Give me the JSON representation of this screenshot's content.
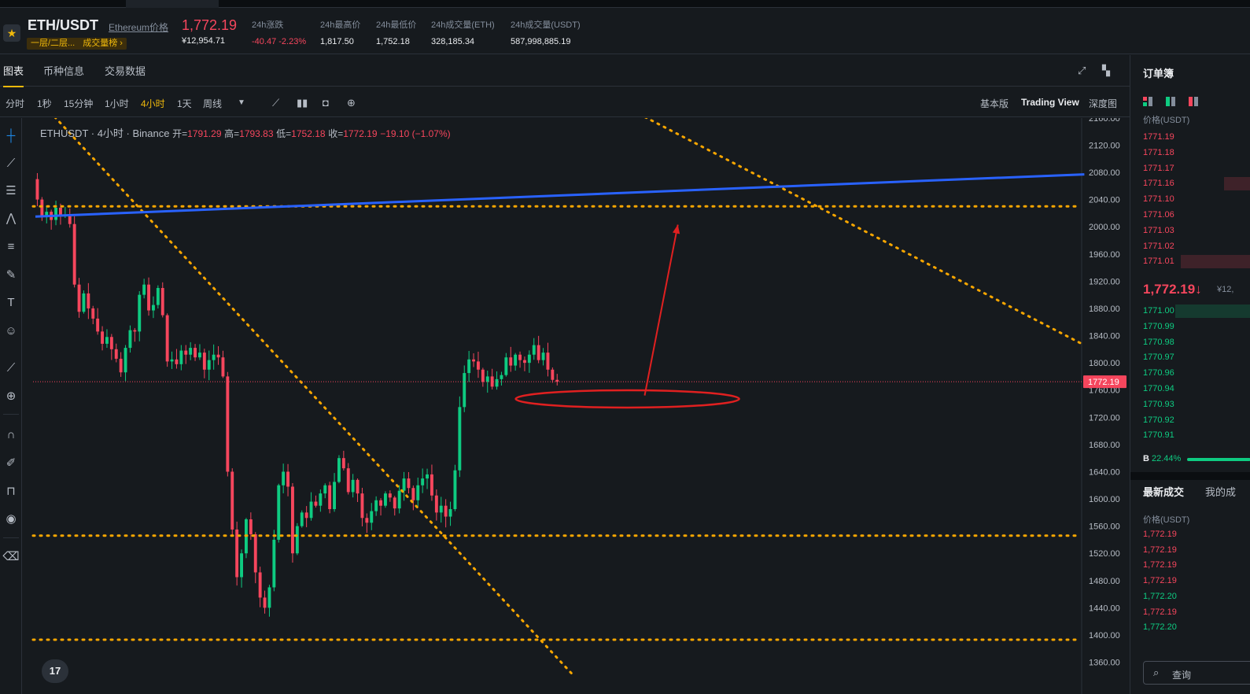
{
  "header": {
    "symbol": "ETH/USDT",
    "symbol_link": "Ethereum价格",
    "tags": [
      "一层/二层...",
      "成交量榜 ›"
    ],
    "last_price": "1,772.19",
    "last_price_fiat": "¥12,954.71",
    "stats": [
      {
        "label": "24h涨跌",
        "value": "-40.47 -2.23%",
        "color": "red"
      },
      {
        "label": "24h最高价",
        "value": "1,817.50"
      },
      {
        "label": "24h最低价",
        "value": "1,752.18"
      },
      {
        "label": "24h成交量(ETH)",
        "value": "328,185.34"
      },
      {
        "label": "24h成交量(USDT)",
        "value": "587,998,885.19"
      }
    ]
  },
  "main_tabs": [
    "图表",
    "币种信息",
    "交易数据"
  ],
  "intervals": [
    "分时",
    "1秒",
    "15分钟",
    "1小时",
    "4小时",
    "1天",
    "周线"
  ],
  "active_interval": "4小时",
  "view_modes": [
    "基本版",
    "Trading View",
    "深度图"
  ],
  "active_view_mode": "Trading View",
  "icons": {
    "star": "star-icon",
    "expand": "expand-icon",
    "layout": "grid-icon",
    "interval_dropdown": "chevron-down-icon",
    "indicators": "indicators-icon",
    "chart_style": "candles-icon",
    "snapshot": "camera-icon",
    "add": "plus-icon",
    "search": "search-icon"
  },
  "left_tools": [
    "crosshair-icon",
    "trendline-icon",
    "horizontal-lines-icon",
    "pattern-icon",
    "fib-icon",
    "brush-icon",
    "text-icon",
    "emoji-icon",
    "ruler-icon",
    "zoom-in-icon",
    "magnet-icon",
    "pencil-lock-icon",
    "lock-icon",
    "eye-icon",
    "trash-icon"
  ],
  "chart_legend": {
    "title": "ETHUSDT · 4小时 · Binance",
    "open_label": "开=",
    "open": "1791.29",
    "high_label": "高=",
    "high": "1793.83",
    "low_label": "低=",
    "low": "1752.18",
    "close_label": "收=",
    "close": "1772.19",
    "change": "−19.10 (−1.07%)"
  },
  "tv_logo": "17",
  "chart_data": {
    "type": "candlestick",
    "title": "ETHUSDT · 4小时 · Binance",
    "ylim": [
      1340,
      2170
    ],
    "y_ticks": [
      2160,
      2120,
      2080,
      2040,
      2000,
      1960,
      1920,
      1880,
      1840,
      1800,
      1760,
      1720,
      1680,
      1640,
      1600,
      1560,
      1520,
      1480,
      1440,
      1400,
      1360
    ],
    "y_tick_labels": [
      "2160.00",
      "2120.00",
      "2080.00",
      "2040.00",
      "2000.00",
      "1960.00",
      "1920.00",
      "1880.00",
      "1840.00",
      "1800.00",
      "1760.00",
      "1720.00",
      "1680.00",
      "1640.00",
      "1600.00",
      "1560.00",
      "1520.00",
      "1480.00",
      "1440.00",
      "1400.00",
      "1360.00"
    ],
    "current_price": 1772.19,
    "current_price_label": "1772.19",
    "closes": [
      2040,
      2014,
      2022,
      2010,
      2028,
      2016,
      2018,
      2004,
      1915,
      1875,
      1902,
      1880,
      1865,
      1846,
      1828,
      1838,
      1820,
      1806,
      1786,
      1822,
      1848,
      1846,
      1900,
      1915,
      1877,
      1885,
      1910,
      1870,
      1802,
      1805,
      1798,
      1818,
      1812,
      1822,
      1808,
      1815,
      1790,
      1804,
      1812,
      1808,
      1780,
      1640,
      1555,
      1485,
      1520,
      1570,
      1548,
      1492,
      1455,
      1440,
      1470,
      1540,
      1620,
      1640,
      1618,
      1520,
      1560,
      1580,
      1572,
      1596,
      1590,
      1608,
      1620,
      1585,
      1625,
      1660,
      1645,
      1610,
      1628,
      1608,
      1572,
      1565,
      1582,
      1598,
      1590,
      1608,
      1602,
      1586,
      1612,
      1630,
      1616,
      1598,
      1620,
      1630,
      1636,
      1605,
      1580,
      1590,
      1574,
      1585,
      1642,
      1735,
      1785,
      1805,
      1802,
      1790,
      1772,
      1780,
      1765,
      1776,
      1782,
      1808,
      1796,
      1812,
      1804,
      1800,
      1812,
      1826,
      1804,
      1815,
      1790,
      1775,
      1772.19
    ],
    "horizontal_levels": [
      2030,
      1546,
      1393
    ],
    "trendlines": [
      {
        "name": "descending-support",
        "points": [
          [
            "bar0",
            2192
          ],
          [
            "bar116",
            1340
          ]
        ]
      },
      {
        "name": "descending-resistance",
        "points": [
          [
            "bar130",
            2166
          ],
          [
            "bar226",
            1826
          ]
        ]
      },
      {
        "name": "ascending-line",
        "points": [
          [
            "bar0",
            2015
          ],
          [
            "bar226",
            2077
          ]
        ]
      }
    ],
    "annotations": [
      {
        "type": "ellipse",
        "center": [
          "bar114",
          1747
        ],
        "note": "support-circle"
      },
      {
        "type": "arrow",
        "from": [
          "bar105",
          1752
        ],
        "to": [
          "bar113",
          2003
        ]
      }
    ],
    "colors": {
      "up": "#0ecb81",
      "down": "#f6465d",
      "levels": "#f7a600",
      "trend": "#2962ff",
      "annotation": "#e02020"
    }
  },
  "orderbook": {
    "title": "订单簿",
    "header": "价格(USDT)",
    "asks": [
      "1771.19",
      "1771.18",
      "1771.17",
      "1771.16",
      "1771.10",
      "1771.06",
      "1771.03",
      "1771.02",
      "1771.01"
    ],
    "ask_depth": [
      0,
      0,
      0,
      0.25,
      0,
      0,
      0,
      0,
      0.65
    ],
    "last": "1,772.19↓",
    "last_fiat": "¥12,",
    "bids": [
      "1771.00",
      "1770.99",
      "1770.98",
      "1770.97",
      "1770.96",
      "1770.94",
      "1770.93",
      "1770.92",
      "1770.91"
    ],
    "bid_depth": [
      0.7,
      0,
      0,
      0,
      0,
      0,
      0,
      0,
      0
    ],
    "buy_label": "B",
    "buy_ratio": "22.44%"
  },
  "trades": {
    "tabs": [
      "最新成交",
      "我的成"
    ],
    "header": "价格(USDT)",
    "rows": [
      {
        "price": "1,772.19",
        "side": "red"
      },
      {
        "price": "1,772.19",
        "side": "red"
      },
      {
        "price": "1,772.19",
        "side": "red"
      },
      {
        "price": "1,772.19",
        "side": "red"
      },
      {
        "price": "1,772.20",
        "side": "green"
      },
      {
        "price": "1,772.19",
        "side": "red"
      },
      {
        "price": "1,772.20",
        "side": "green"
      }
    ],
    "search_placeholder": "查询"
  }
}
